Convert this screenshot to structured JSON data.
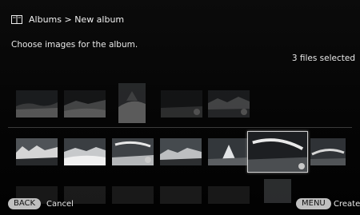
{
  "header": {
    "icon": "album-book-icon",
    "breadcrumb": "Albums > New album"
  },
  "prompt": "Choose images for the album.",
  "selection_count": "3 files selected",
  "footer": {
    "back_button": "BACK",
    "back_label": "Cancel",
    "menu_button": "MENU",
    "menu_label": "Create"
  },
  "thumbnails": {
    "row1": [
      {
        "name": "thumb-row1-1",
        "selected": false
      },
      {
        "name": "thumb-row1-2",
        "selected": false
      },
      {
        "name": "thumb-row1-3",
        "selected": false
      },
      {
        "name": "thumb-row1-4",
        "selected": true
      },
      {
        "name": "thumb-row1-5",
        "selected": true
      }
    ],
    "row2": [
      {
        "name": "thumb-row2-1",
        "selected": false
      },
      {
        "name": "thumb-row2-2",
        "selected": false
      },
      {
        "name": "thumb-row2-3",
        "selected": true
      },
      {
        "name": "thumb-row2-4",
        "selected": false
      },
      {
        "name": "thumb-row2-5",
        "selected": false
      },
      {
        "name": "thumb-row2-6",
        "selected": true,
        "focused": true
      },
      {
        "name": "thumb-row2-7",
        "selected": false
      }
    ]
  }
}
